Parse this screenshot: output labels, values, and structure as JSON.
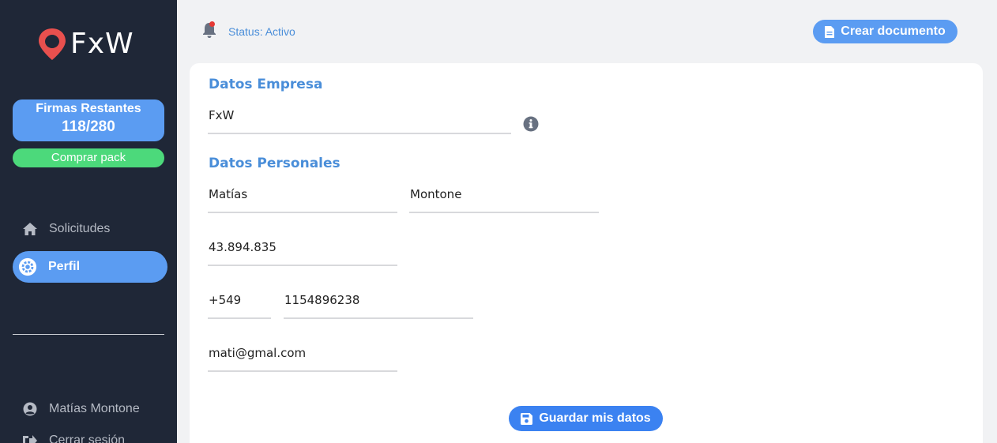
{
  "brand": {
    "name": "FxW"
  },
  "credits": {
    "title": "Firmas Restantes",
    "count": "118/280",
    "buy_label": "Comprar pack"
  },
  "nav": {
    "items": [
      {
        "label": "Solicitudes",
        "icon": "home-icon"
      },
      {
        "label": "Perfil",
        "icon": "gear-icon"
      }
    ]
  },
  "user": {
    "name": "Matías Montone",
    "logout_label": "Cerrar sesión"
  },
  "header": {
    "status": "Status: Activo",
    "create_label": "Crear documento"
  },
  "form": {
    "company_section": "Datos Empresa",
    "company_name": "FxW",
    "personal_section": "Datos Personales",
    "first_name": "Matías",
    "last_name": "Montone",
    "document_id": "43.894.835",
    "phone_code": "+549",
    "phone_number": "1154896238",
    "email": "mati@gmal.com",
    "save_label": "Guardar mis datos"
  },
  "colors": {
    "sidebar": "#1f2737",
    "accent": "#5b9cf2",
    "success": "#4cd97b",
    "logo": "#e8504e"
  }
}
